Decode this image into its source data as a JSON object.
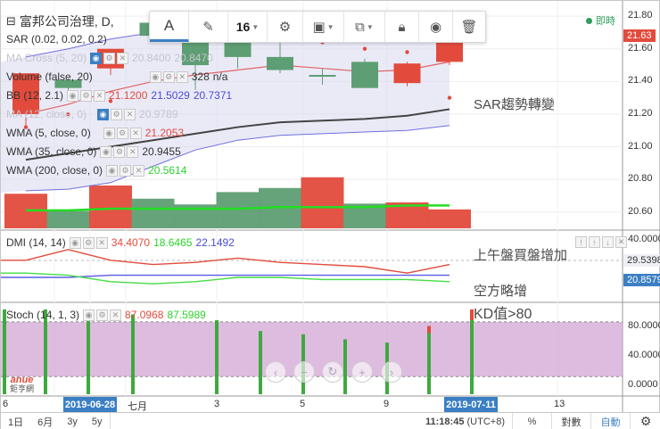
{
  "title": {
    "collapse_icon": "⊟",
    "text": "富邦公司治理, D,"
  },
  "live": {
    "label": "即時",
    "color": "#2e9e5b"
  },
  "toolbar": {
    "text_tool": "A",
    "font_size": "16"
  },
  "legends": {
    "sar": {
      "label": "SAR (0.02, 0.02, 0.2)"
    },
    "ma_cross": {
      "label": "MA Cross (5, 20)",
      "v1": "20.8400",
      "v2": "20.8470"
    },
    "volume": {
      "label": "Volume (false, 20)",
      "v1": "328",
      "v2": "n/a"
    },
    "bb": {
      "label": "BB (12, 2.1)",
      "v1": "21.1200",
      "v2": "21.5029",
      "v3": "20.7371"
    },
    "hidden": {
      "label": "MA (12, close, 0)",
      "v1": "20.9789"
    },
    "wma5": {
      "label": "WMA (5, close, 0)",
      "v1": "21.2053"
    },
    "wma35": {
      "label": "WMA (35, close, 0)",
      "v1": "20.9455"
    },
    "wma200": {
      "label": "WMA (200, close, 0)",
      "v1": "20.5614"
    },
    "dmi": {
      "label": "DMI (14, 14)",
      "v1": "34.4070",
      "v2": "18.6465",
      "v3": "22.1492"
    },
    "stoch": {
      "label": "Stoch (14, 1, 3)",
      "v1": "87.0968",
      "v2": "87.5989"
    }
  },
  "price_axis": [
    "21.80",
    "21.60",
    "21.40",
    "21.20",
    "21.00",
    "20.80",
    "20.60"
  ],
  "price_current": {
    "value": "21.63",
    "color": "#e24b3c"
  },
  "dmi_axis": [
    "40.0000"
  ],
  "dmi_tags": [
    {
      "value": "29.5398",
      "style": "light"
    },
    {
      "value": "20.8579",
      "style": "blue"
    }
  ],
  "stoch_axis": [
    "80.0000",
    "40.0000",
    "0.0000"
  ],
  "annotations": {
    "sar_reversal": "SAR趨勢轉變",
    "buy_increase": "上午盤買盤增加",
    "bearish": "空方略增",
    "kd": "KD值>80"
  },
  "date_axis": {
    "labels": [
      "6",
      "七月",
      "3",
      "5",
      "9",
      "13"
    ],
    "start_tag": "2019-06-28",
    "end_tag": "2019-07-11"
  },
  "bottom_bar": {
    "ranges": [
      "1日",
      "6月",
      "3y",
      "5y"
    ],
    "time": "11:18:45",
    "tz": "(UTC+8)",
    "percent": "%",
    "log": "對數",
    "auto": "自動"
  },
  "watermark": {
    "brand": "anue",
    "sub": "鉅亨網"
  },
  "chart_data": {
    "type": "candlestick",
    "candles": [
      {
        "o": 21.2,
        "h": 21.45,
        "l": 21.12,
        "c": 21.45,
        "up": true
      },
      {
        "o": 21.36,
        "h": 21.42,
        "l": 21.3,
        "c": 21.41,
        "up": false
      },
      {
        "o": 21.48,
        "h": 21.6,
        "l": 21.44,
        "c": 21.6,
        "up": true
      },
      {
        "o": 21.76,
        "h": 21.82,
        "l": 21.66,
        "c": 21.68,
        "up": false
      },
      {
        "o": 21.65,
        "h": 21.75,
        "l": 21.35,
        "c": 21.5,
        "up": false
      },
      {
        "o": 21.55,
        "h": 21.7,
        "l": 21.48,
        "c": 21.66,
        "up": false
      },
      {
        "o": 21.55,
        "h": 21.65,
        "l": 21.45,
        "c": 21.47,
        "up": false
      },
      {
        "o": 21.43,
        "h": 21.48,
        "l": 21.38,
        "c": 21.44,
        "up": false
      },
      {
        "o": 21.36,
        "h": 21.54,
        "l": 21.36,
        "c": 21.52,
        "up": false
      },
      {
        "o": 21.39,
        "h": 21.52,
        "l": 21.37,
        "c": 21.51,
        "up": true
      },
      {
        "o": 21.52,
        "h": 21.64,
        "l": 21.5,
        "c": 21.64,
        "up": true
      }
    ],
    "volumes": [
      {
        "v": 420,
        "up": true
      },
      {
        "v": 210,
        "up": false
      },
      {
        "v": 520,
        "up": true
      },
      {
        "v": 360,
        "up": false
      },
      {
        "v": 290,
        "up": false
      },
      {
        "v": 440,
        "up": false
      },
      {
        "v": 490,
        "up": false
      },
      {
        "v": 620,
        "up": true
      },
      {
        "v": 300,
        "up": false
      },
      {
        "v": 315,
        "up": true
      },
      {
        "v": 230,
        "up": true
      }
    ],
    "bb_upper": [
      21.55,
      21.6,
      21.66,
      21.7,
      21.7,
      21.69,
      21.67,
      21.66,
      21.65,
      21.66,
      21.69
    ],
    "bb_lower": [
      20.73,
      20.74,
      20.78,
      20.88,
      20.98,
      21.04,
      21.07,
      21.08,
      21.09,
      21.1,
      21.13
    ],
    "wma5": [
      21.2,
      21.26,
      21.34,
      21.4,
      21.44,
      21.47,
      21.5,
      21.48,
      21.46,
      21.47,
      21.52
    ],
    "wma35": [
      20.92,
      20.96,
      21.0,
      21.04,
      21.08,
      21.12,
      21.15,
      21.16,
      21.17,
      21.19,
      21.23
    ],
    "wma200": [
      20.61,
      20.61,
      20.62,
      20.62,
      20.62,
      20.62,
      20.63,
      20.63,
      20.63,
      20.64,
      20.64
    ],
    "sar": [
      21.12,
      21.2,
      21.28,
      21.8,
      21.76,
      21.72,
      21.68,
      21.64,
      21.6,
      21.58,
      21.3
    ],
    "dmi_adx": [
      28,
      33,
      28,
      26,
      27,
      29,
      27,
      26,
      25,
      22,
      26
    ],
    "dmi_plus": [
      20,
      20,
      21,
      21,
      21,
      21,
      21,
      21,
      21,
      21,
      21
    ],
    "dmi_minus": [
      22,
      21,
      18,
      17,
      18,
      20,
      20,
      19,
      19,
      19,
      18
    ],
    "stoch_bars": [
      {
        "v": 98,
        "tick": 0
      },
      {
        "v": 98,
        "tick": 0
      },
      {
        "v": 97,
        "tick": 0
      },
      {
        "v": 92,
        "tick": 0
      },
      {
        "v": 85,
        "tick": 0
      },
      {
        "v": 72,
        "tick": 0
      },
      {
        "v": 68,
        "tick": 0
      },
      {
        "v": 62,
        "tick": 0
      },
      {
        "v": 58,
        "tick": 0
      },
      {
        "v": 78,
        "tick": 8
      },
      {
        "v": 98,
        "tick": 12
      }
    ],
    "stoch_band": [
      20,
      80
    ],
    "ylim_price": [
      20.5,
      21.85
    ],
    "ylim_dmi": [
      10,
      40
    ],
    "colors": {
      "up": "#e24b3c",
      "down": "#5e9e74",
      "bb_fill": "#d8d8f0",
      "bb_line": "#6f6fe0",
      "wma5": "#e06666",
      "wma35": "#444444",
      "wma200": "#22dd22",
      "vol_up": "#e24b3c",
      "vol_down": "#5e9e74",
      "adx": "#e24b3c",
      "plus": "#5b5be6",
      "minus": "#44dd44",
      "stoch_band": "#d3a6d6",
      "stoch_bar": "#3fa93f",
      "stoch_tick": "#e24b3c",
      "accent": "#3b7fc4"
    }
  }
}
